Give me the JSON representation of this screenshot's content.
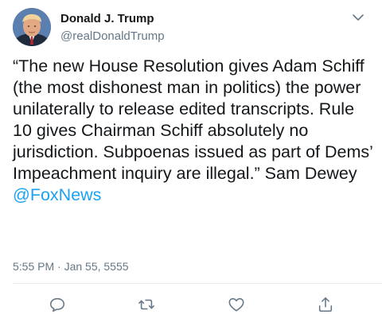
{
  "author": {
    "display_name": "Donald J. Trump",
    "handle": "@realDonaldTrump",
    "avatar_icon": "profile-avatar"
  },
  "tweet": {
    "text": "“The new House Resolution gives Adam Schiff (the most dishonest man in politics) the power unilaterally to release edited transcripts. Rule 10 gives Chairman Schiff absolutely no jurisdiction. Subpoenas issued as part of Dems’ Impeachment inquiry are illegal.” Sam Dewey ",
    "mention": "@FoxNews",
    "timestamp": "5:55 PM · Jan 55, 5555"
  },
  "actions": {
    "reply_icon": "reply-icon",
    "retweet_icon": "retweet-icon",
    "like_icon": "like-icon",
    "share_icon": "share-icon"
  },
  "colors": {
    "text": "#14171a",
    "secondary": "#657786",
    "link": "#1da1f2",
    "divider": "#e6ecf0"
  }
}
